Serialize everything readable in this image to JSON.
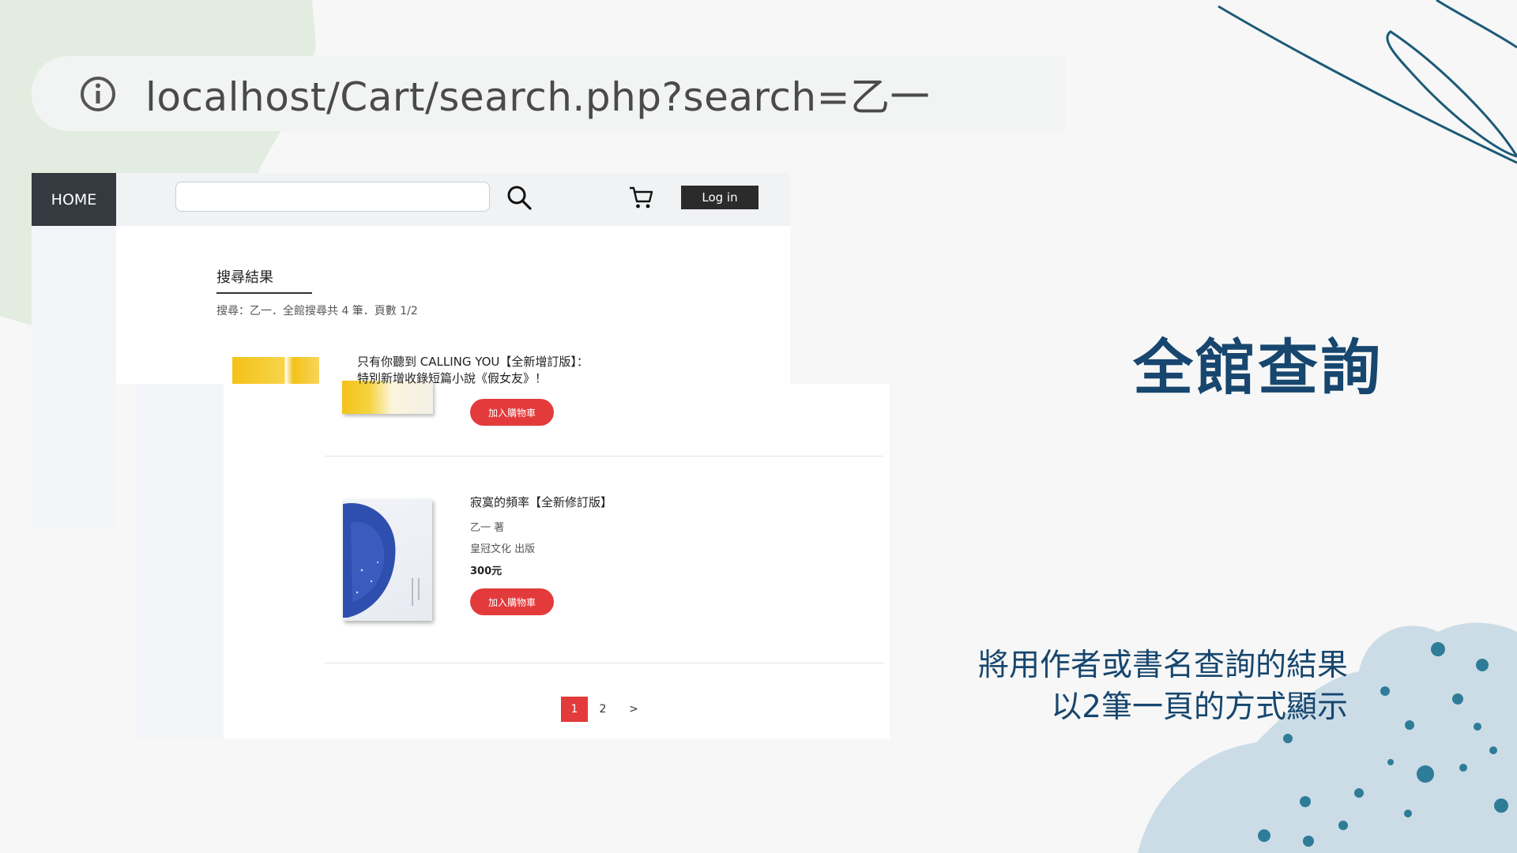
{
  "url_bar": {
    "icon": "info-icon",
    "text": "localhost/Cart/search.php?search=乙一"
  },
  "nav": {
    "home_label": "HOME",
    "search_placeholder": "",
    "search_icon": "search-icon",
    "cart_icon": "cart-icon",
    "login_label": "Log in"
  },
  "results": {
    "title": "搜尋結果",
    "summary": "搜尋：乙一．全館搜尋共 4 筆．頁數 1/2"
  },
  "books": [
    {
      "title_line1": "只有你聽到 CALLING YOU【全新增訂版】：",
      "title_line2": "特別新增收錄短篇小說《假女友》！",
      "add_to_cart": "加入購物車"
    },
    {
      "title": "寂寞的頻率【全新修訂版】",
      "author": "乙一 著",
      "publisher": "皇冠文化 出版",
      "price": "300元",
      "add_to_cart": "加入購物車"
    }
  ],
  "pagination": {
    "pages": [
      "1",
      "2"
    ],
    "current": "1",
    "next": ">"
  },
  "slide": {
    "heading": "全館查詢",
    "description_line1": "將用作者或書名查詢的結果",
    "description_line2": "以2筆一頁的方式顯示"
  },
  "colors": {
    "accent_red": "#e33a3c",
    "heading_blue": "#17466e",
    "nav_dark": "#343a40"
  }
}
